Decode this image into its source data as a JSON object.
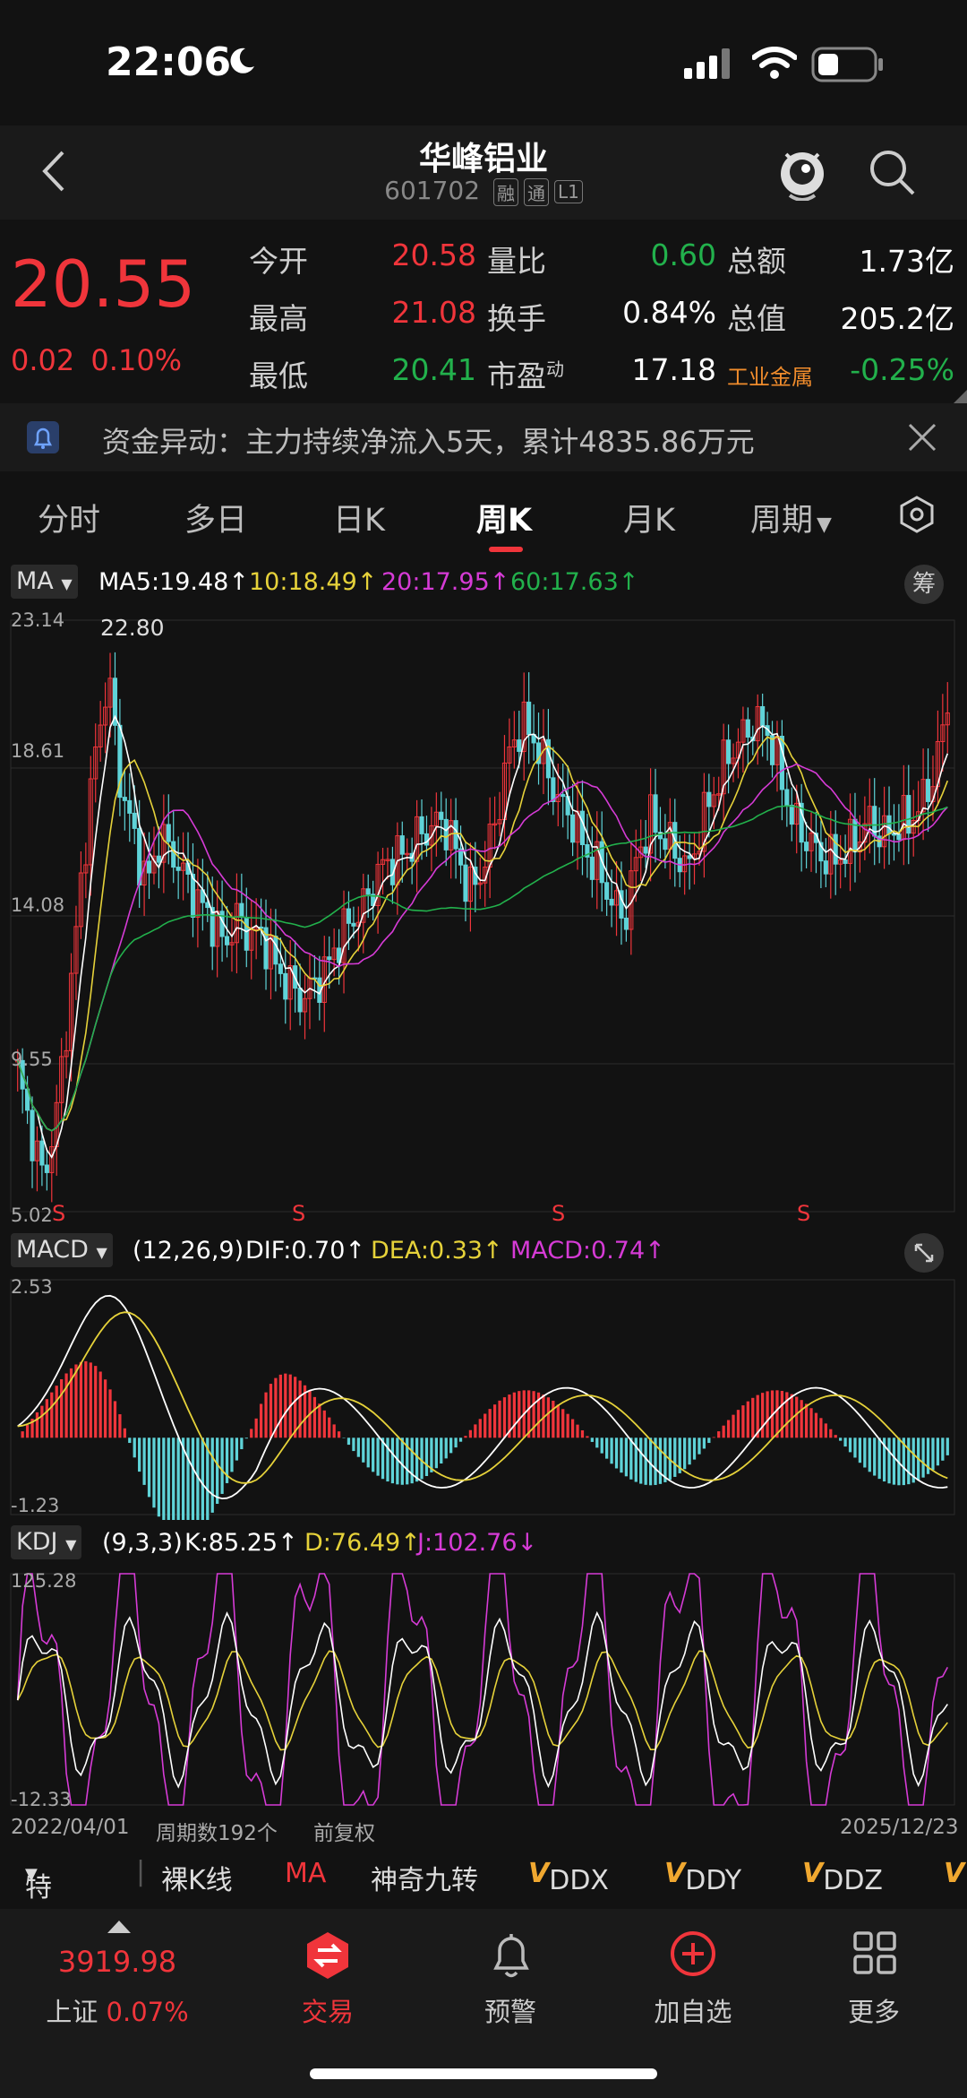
{
  "status": {
    "time": "22:06"
  },
  "header": {
    "title": "华峰铝业",
    "code": "601702",
    "tags": [
      "融",
      "通",
      "L1"
    ]
  },
  "quote": {
    "price": "20.55",
    "change": "0.02",
    "change_pct": "0.10%",
    "rows": [
      {
        "l1": "今开",
        "v1": "20.58",
        "l2": "量比",
        "v2": "0.60",
        "l3": "总额",
        "v3": "1.73亿"
      },
      {
        "l1": "最高",
        "v1": "21.08",
        "l2": "换手",
        "v2": "0.84%",
        "l3": "总值",
        "v3": "205.2亿"
      },
      {
        "l1": "最低",
        "v1": "20.41",
        "l2": "市盈",
        "l2sup": "动",
        "v2": "17.18",
        "l3": "工业金属",
        "v3": "-0.25%"
      }
    ]
  },
  "notice": {
    "text": "资金异动：主力持续净流入5天，累计4835.86万元"
  },
  "tabs": [
    "分时",
    "多日",
    "日K",
    "周K",
    "月K",
    "周期"
  ],
  "main_chart": {
    "selector": "MA",
    "ma5": "MA5:19.48↑",
    "ma10": "10:18.49↑",
    "ma20": "20:17.95↑",
    "ma60": "60:17.63↑",
    "chip_button": "筹",
    "y_ticks": [
      "23.14",
      "18.61",
      "14.08",
      "9.55",
      "5.02"
    ],
    "max_label": "22.80",
    "signal": "S"
  },
  "macd": {
    "selector": "MACD",
    "params": "(12,26,9)",
    "dif": "DIF:0.70↑",
    "dea": "DEA:0.33↑",
    "macd": "MACD:0.74↑",
    "y_top": "2.53",
    "y_bottom": "-1.23"
  },
  "kdj": {
    "selector": "KDJ",
    "params": "(9,3,3)",
    "k": "K:85.25↑",
    "d": "D:76.49↑",
    "j": "J:102.76↓",
    "y_top": "125.28",
    "y_bottom": "-12.33"
  },
  "footer_axis": {
    "start": "2022/04/01",
    "count": "周期数192个",
    "adjust": "前复权",
    "end": "2025/12/23"
  },
  "toolbar": {
    "special": "特色",
    "items": [
      "裸K线",
      "MA",
      "神奇九转",
      "DDX",
      "DDY",
      "DDZ"
    ]
  },
  "bottom_nav": {
    "index_value": "3919.98",
    "index_name": "上证",
    "index_pct": "0.07%",
    "items": [
      "交易",
      "预警",
      "加自选",
      "更多"
    ]
  },
  "chart_data": [
    {
      "type": "candlestick",
      "title": "",
      "y_range": [
        5.02,
        23.14
      ],
      "y_ticks": [
        23.14,
        18.61,
        14.08,
        9.55,
        5.02
      ],
      "x_range": [
        "2022/04/01",
        "2025/12/23"
      ],
      "series": [
        {
          "name": "MA5",
          "value": 19.48
        },
        {
          "name": "MA10",
          "value": 18.49
        },
        {
          "name": "MA20",
          "value": 17.95
        },
        {
          "name": "MA60",
          "value": 17.63
        }
      ],
      "close_path": [
        9.3,
        7.5,
        6.0,
        8.0,
        11.5,
        15.5,
        19.0,
        21.5,
        18.0,
        16.5,
        15.0,
        16.5,
        16.0,
        15.2,
        14.5,
        14.0,
        13.2,
        14.0,
        13.5,
        13.5,
        12.5,
        12.0,
        11.5,
        12.0,
        12.5,
        13.5,
        14.0,
        14.5,
        15.5,
        15.8,
        16.0,
        16.5,
        16.8,
        17.0,
        16.0,
        14.8,
        15.5,
        17.0,
        19.0,
        20.0,
        19.5,
        18.5,
        17.5,
        17.0,
        16.0,
        15.5,
        14.5,
        14.0,
        16.0,
        17.0,
        16.5,
        16.0,
        15.5,
        17.0,
        18.0,
        19.0,
        19.5,
        20.0,
        19.8,
        18.5,
        17.0,
        16.5,
        16.0,
        15.8,
        16.0,
        16.5,
        17.0,
        16.5,
        16.8,
        17.0,
        17.5,
        18.5,
        20.55
      ],
      "max_label": 22.8
    },
    {
      "type": "bar",
      "title": "MACD",
      "y_range": [
        -1.23,
        2.53
      ],
      "series": [
        {
          "name": "DIF",
          "value": 0.7
        },
        {
          "name": "DEA",
          "value": 0.33
        },
        {
          "name": "MACD",
          "value": 0.74
        }
      ]
    },
    {
      "type": "line",
      "title": "KDJ",
      "y_range": [
        -12.33,
        125.28
      ],
      "series": [
        {
          "name": "K",
          "value": 85.25
        },
        {
          "name": "D",
          "value": 76.49
        },
        {
          "name": "J",
          "value": 102.76
        }
      ]
    }
  ]
}
